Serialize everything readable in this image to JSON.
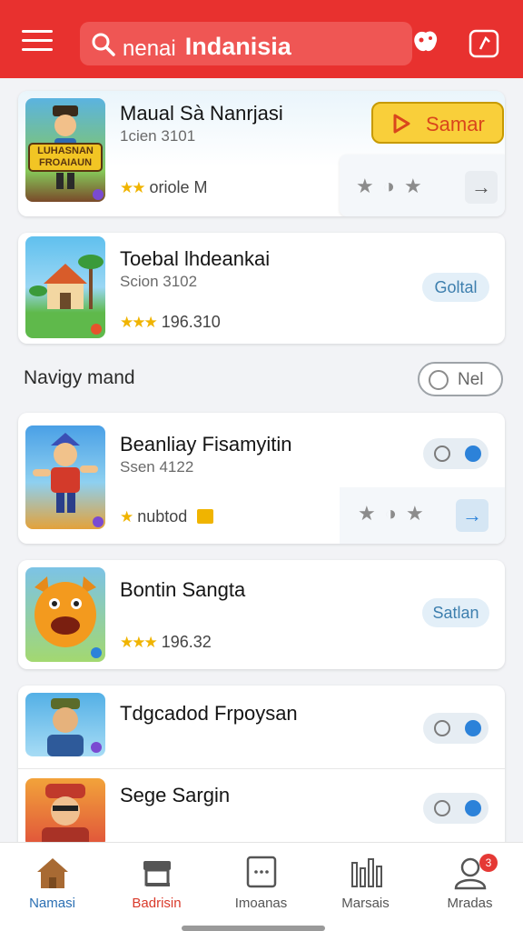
{
  "header": {
    "search_query": "nenai",
    "search_bold": "Indanisia"
  },
  "apps": [
    {
      "title": "Maual Sà Nanrjasi",
      "sub": "1cien  3101",
      "meta": "oriole M",
      "stars": "★★",
      "action": "Samar",
      "thumb_text": "LUHASNAN FROAIAUN"
    },
    {
      "title": "Toebal lhdeankai",
      "sub": "Scion  3102",
      "meta": "196.310",
      "stars": "★★★",
      "action": "Goltal"
    },
    {
      "title": "Beanliay Fisamyitin",
      "sub": "Ssen  4122",
      "meta": "nubtod",
      "stars": "★"
    },
    {
      "title": "Bontin Sangta",
      "sub": "",
      "meta": "196.32",
      "stars": "★★★",
      "action": "Satlan"
    },
    {
      "title": "Tdgcadod Frpoysan",
      "sub": "",
      "meta": ""
    },
    {
      "title": "Sege Sargin",
      "sub": "",
      "meta": ""
    }
  ],
  "section": {
    "title": "Navigy mand",
    "button": "Nel"
  },
  "nav": [
    {
      "label": "Namasi",
      "color": "#2b6fb3"
    },
    {
      "label": "Badrisin",
      "color": "#d93a2b"
    },
    {
      "label": "Imoanas",
      "color": "#555555"
    },
    {
      "label": "Marsais",
      "color": "#555555"
    },
    {
      "label": "Mradas",
      "color": "#555555",
      "badge": "3"
    }
  ],
  "colors": {
    "accent": "#e8312f",
    "star": "#f0b400",
    "pill": "#e3eff8"
  }
}
